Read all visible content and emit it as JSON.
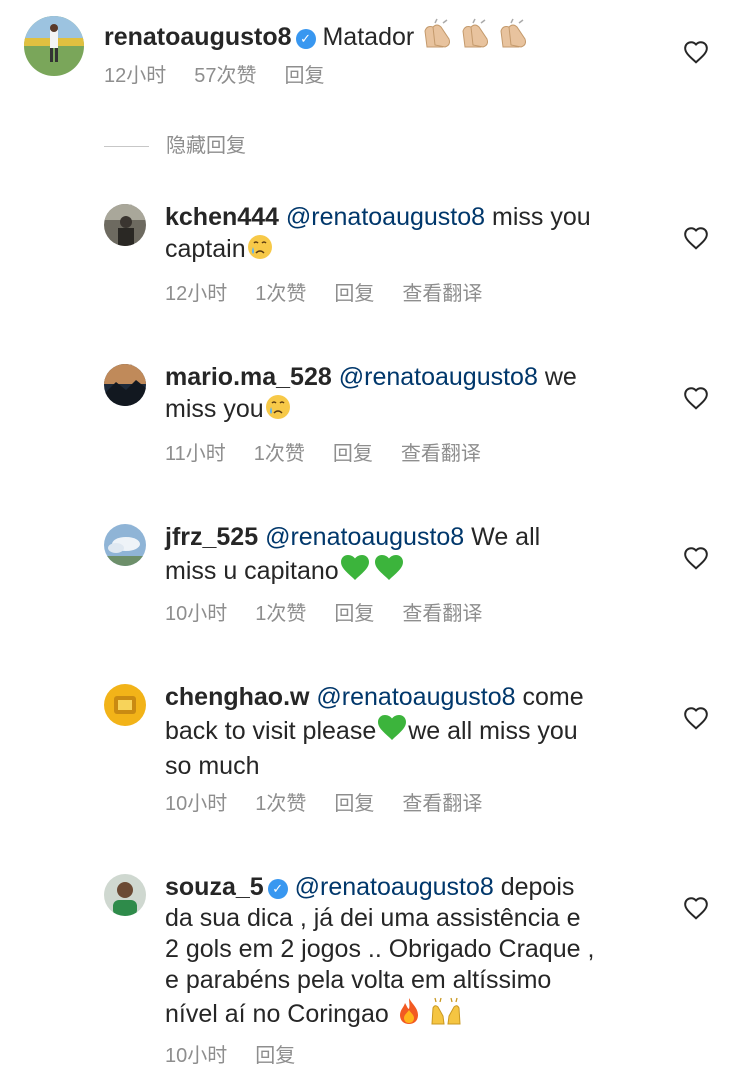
{
  "comments": [
    {
      "username": "renatoaugusto8",
      "verified": true,
      "text": "Matador",
      "time": "12小时",
      "likes": "57次赞",
      "reply": "回复"
    },
    {
      "username": "kchen444",
      "mention": "@renatoaugusto8",
      "text_line1": "miss you",
      "text_line2": "captain",
      "time": "12小时",
      "likes": "1次赞",
      "reply": "回复",
      "translate": "查看翻译"
    },
    {
      "username": "mario.ma_528",
      "mention": "@renatoaugusto8",
      "text_line1": "we",
      "text_line2": "miss you",
      "time": "11小时",
      "likes": "1次赞",
      "reply": "回复",
      "translate": "查看翻译"
    },
    {
      "username": "jfrz_525",
      "mention": "@renatoaugusto8",
      "text_line1": "We all",
      "text_line2": "miss u capitano",
      "time": "10小时",
      "likes": "1次赞",
      "reply": "回复",
      "translate": "查看翻译"
    },
    {
      "username": "chenghao.w",
      "mention": "@renatoaugusto8",
      "text_line1": "come",
      "text_line2a": "back to visit please",
      "text_line2b": "we all miss you",
      "text_line3": "so much",
      "time": "10小时",
      "likes": "1次赞",
      "reply": "回复",
      "translate": "查看翻译"
    },
    {
      "username": "souza_5",
      "verified": true,
      "mention": "@renatoaugusto8",
      "text_line1": "depois",
      "text_line2": "da sua dica , já dei uma assistência e",
      "text_line3": "2 gols em 2 jogos .. Obrigado Craque ,",
      "text_line4": "e parabéns pela volta em altíssimo",
      "text_line5": "nível aí no Coringao",
      "time": "10小时",
      "reply": "回复"
    }
  ],
  "hidden_replies_label": "隐藏回复",
  "icons": {
    "like": "heart-outline-icon",
    "verified": "verified-badge-icon"
  },
  "colors": {
    "mention": "#00376b",
    "meta": "#8e8e8e",
    "verified": "#3897f0",
    "green_heart": "#3cb43c"
  }
}
